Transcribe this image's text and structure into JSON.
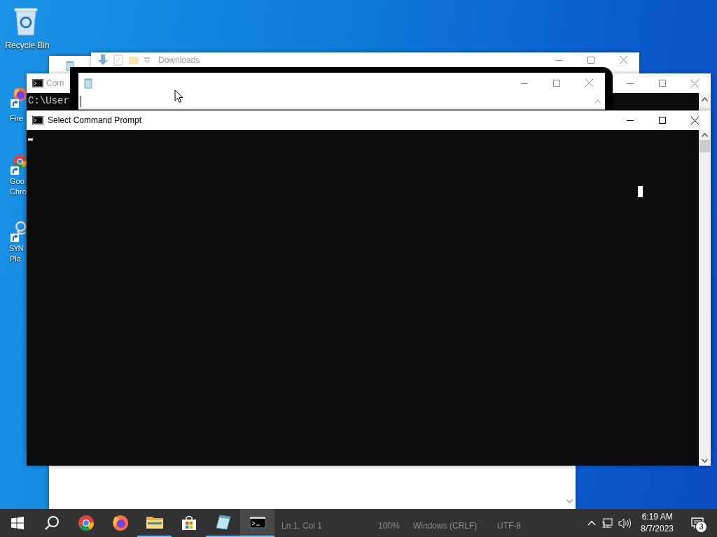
{
  "desktop_icons": [
    {
      "kind": "recycle",
      "lines": [
        "Recycle Bin"
      ]
    },
    {
      "kind": "firefox",
      "lines": [
        "Fire"
      ]
    },
    {
      "kind": "chrome",
      "lines": [
        "Goo",
        "Chro"
      ]
    },
    {
      "kind": "app",
      "lines": [
        "SYN",
        "Pla"
      ]
    }
  ],
  "windows": [
    {
      "kind": "explorer",
      "title": "Downloads",
      "active": false
    },
    {
      "kind": "notepad",
      "status_bar": [
        "Ln 1, Col 1",
        "100%",
        "Windows (CRLF)",
        "UTF-8"
      ]
    },
    {
      "kind": "console",
      "title": "Com",
      "active": false,
      "lines": [
        "C:\\User"
      ]
    },
    {
      "kind": "snap",
      "active": false
    },
    {
      "kind": "console",
      "title": "Select Command Prompt",
      "active": true
    }
  ],
  "taskbar": {
    "apps": [
      {
        "kind": "start",
        "running": false,
        "active": false
      },
      {
        "kind": "search",
        "running": false,
        "active": false
      },
      {
        "kind": "chrome",
        "running": false,
        "active": false
      },
      {
        "kind": "firefox",
        "running": false,
        "active": false
      },
      {
        "kind": "folder",
        "running": true,
        "active": false
      },
      {
        "kind": "store",
        "running": false,
        "active": false
      },
      {
        "kind": "notepad",
        "running": true,
        "active": false
      },
      {
        "kind": "console",
        "running": true,
        "active": true
      }
    ],
    "time": "6:19 AM",
    "date": "8/7/2023",
    "notifications": "3"
  }
}
